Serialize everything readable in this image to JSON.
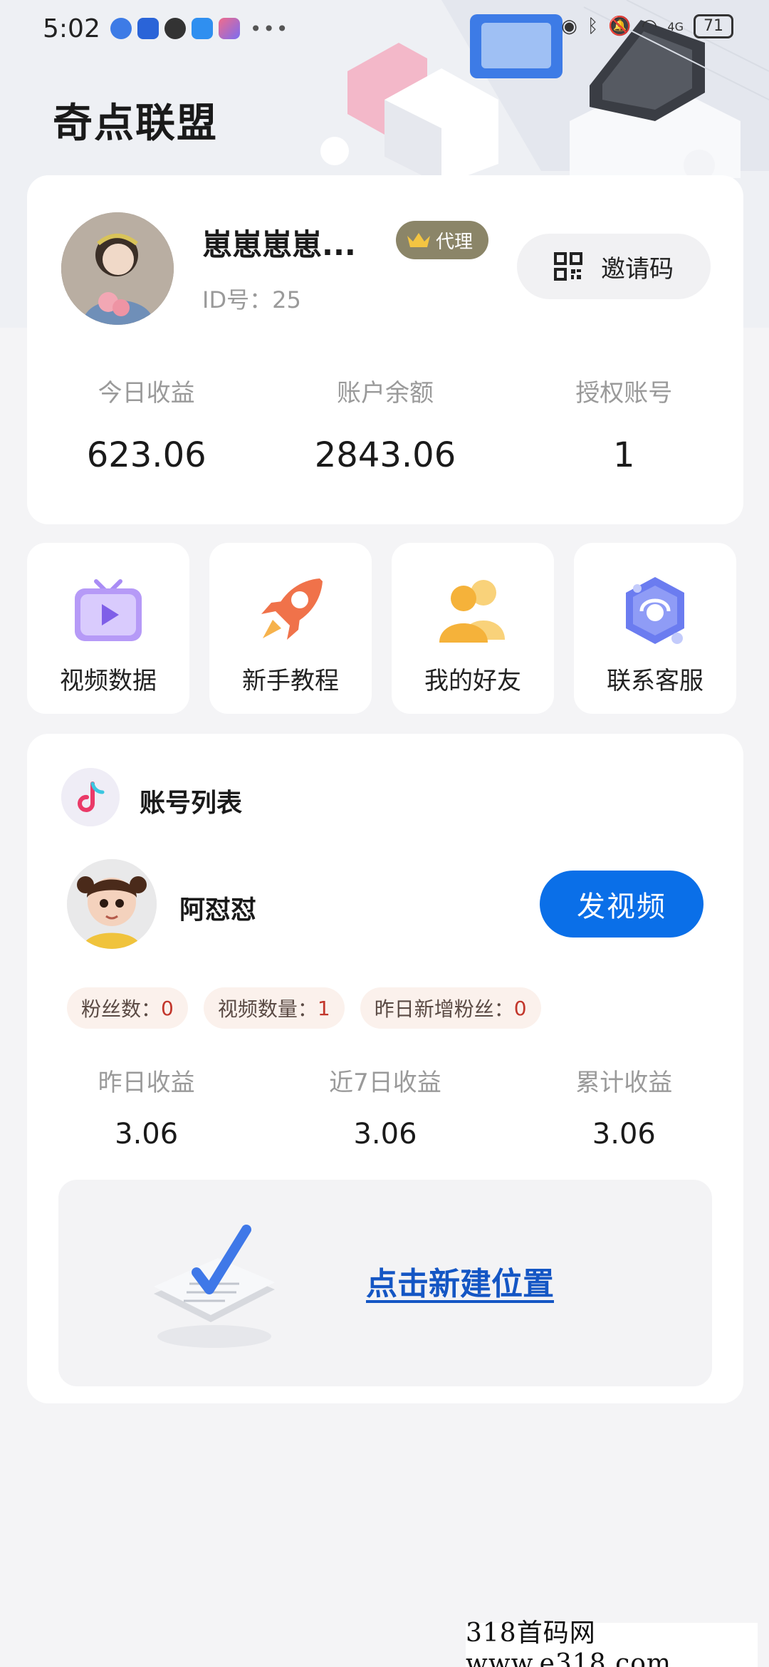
{
  "status_bar": {
    "time": "5:02",
    "battery": "71",
    "network": "4G"
  },
  "app": {
    "title": "奇点联盟"
  },
  "profile": {
    "username": "崽崽崽崽...",
    "badge": "代理",
    "id_text": "ID号：25",
    "invite_label": "邀请码",
    "stats": [
      {
        "label": "今日收益",
        "value": "623.06"
      },
      {
        "label": "账户余额",
        "value": "2843.06"
      },
      {
        "label": "授权账号",
        "value": "1"
      }
    ]
  },
  "shortcuts": [
    {
      "label": "视频数据",
      "icon": "tv-play-icon"
    },
    {
      "label": "新手教程",
      "icon": "rocket-icon"
    },
    {
      "label": "我的好友",
      "icon": "friends-icon"
    },
    {
      "label": "联系客服",
      "icon": "customer-service-icon"
    }
  ],
  "account_list": {
    "title": "账号列表",
    "account": {
      "name": "阿怼怼",
      "post_button": "发视频",
      "tags": [
        {
          "label": "粉丝数：",
          "value": "0"
        },
        {
          "label": "视频数量：",
          "value": "1"
        },
        {
          "label": "昨日新增粉丝：",
          "value": "0"
        }
      ],
      "stats": [
        {
          "label": "昨日收益",
          "value": "3.06"
        },
        {
          "label": "近7日收益",
          "value": "3.06"
        },
        {
          "label": "累计收益",
          "value": "3.06"
        }
      ]
    },
    "new_position_link": "点击新建位置"
  },
  "watermark": "318首码网  www.e318.com",
  "colors": {
    "primary": "#0a6fe8",
    "link": "#1456c4",
    "badge": "#8b8568",
    "tag_value": "#c2362b"
  }
}
